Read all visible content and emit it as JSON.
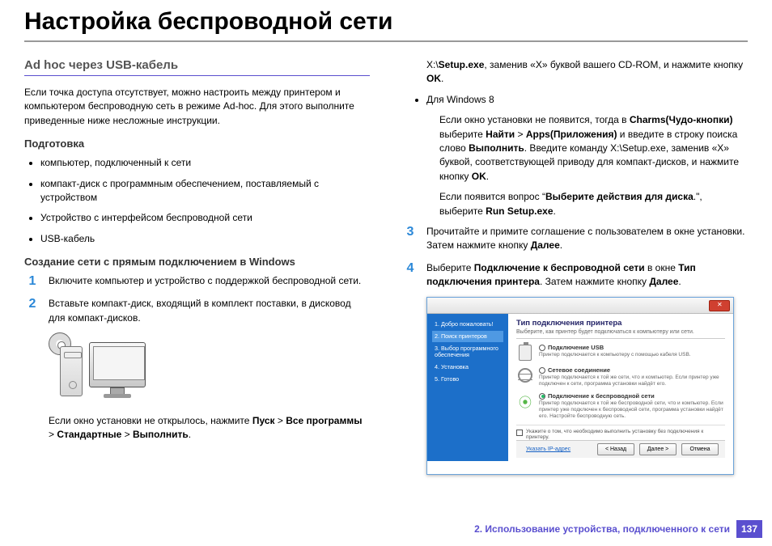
{
  "title": "Настройка беспроводной сети",
  "left": {
    "h2": "Ad hoc через USB-кабель",
    "intro": "Если точка доступа отсутствует, можно настроить между принтером и компьютером беспроводную сеть в режиме Ad-hoc. Для этого выполните приведенные ниже несложные инструкции.",
    "h3a": "Подготовка",
    "bullets": [
      "компьютер, подключенный к сети",
      "компакт-диск с программным обеспечением, поставляемый с устройством",
      "Устройство с интерфейсом беспроводной сети",
      "USB-кабель"
    ],
    "h3b": "Создание сети с прямым подключением в Windows",
    "step1": "Включите компьютер и устройство с поддержкой беспроводной сети.",
    "step2": "Вставьте компакт-диск, входящий в комплект поставки, в дисковод для компакт-дисков.",
    "note_indent_pre": "Если окно установки не открылось, нажмите ",
    "note_path": [
      "Пуск",
      "Все программы",
      "Стандартные",
      "Выполнить"
    ]
  },
  "right": {
    "topline_pre": "X:\\",
    "topline_setup": "Setup.exe",
    "topline_mid": ", заменив «X» буквой вашего CD-ROM, и нажмите кнопку ",
    "topline_ok": "OK",
    "win8_label": "Для Windows 8",
    "win8_p1a": "Если окно установки не появится, тогда в ",
    "win8_charms": "Charms(Чудо-кнопки)",
    "win8_p1b": " выберите ",
    "win8_find": "Найти",
    "win8_p1c": " > ",
    "win8_apps": "Apps(Приложения)",
    "win8_p1d": " и введите в строку поиска слово ",
    "win8_run": "Выполнить",
    "win8_p1e": ". Введите команду X:\\Setup.exe, заменив «X» буквой, соответствующей приводу для компакт-дисков, и нажмите кнопку ",
    "win8_ok": "OK",
    "win8_p2a": "Если появится вопрос “",
    "win8_p2b": "Выберите действия для диска",
    "win8_p2c": ".\", выберите ",
    "win8_runsetup": "Run Setup.exe",
    "step3a": "Прочитайте и примите соглашение с пользователем в окне установки. Затем нажмите кнопку ",
    "step3b": "Далее",
    "step4a": "Выберите ",
    "step4b": "Подключение к беспроводной сети",
    "step4c": " в окне ",
    "step4d": "Тип подключения принтера",
    "step4e": ". Затем нажмите кнопку ",
    "step4f": "Далее"
  },
  "dialog": {
    "side": [
      "1. Добро пожаловать!",
      "2. Поиск принтеров",
      "3. Выбор программного обеспечения",
      "4. Установка",
      "5. Готово"
    ],
    "heading": "Тип подключения принтера",
    "sub": "Выберите, как принтер будет подключаться к компьютеру или сети.",
    "opt1_t": "Подключение USB",
    "opt1_d": "Принтер подключается к компьютеру с помощью кабеля USB.",
    "opt2_t": "Сетевое соединение",
    "opt2_d": "Принтер подключается к той же сети, что и компьютер. Если принтер уже подключен к сети, программа установки найдёт его.",
    "opt3_t": "Подключение к беспроводной сети",
    "opt3_d": "Принтер подключается к той же беспроводной сети, что и компьютер. Если принтер уже подключен к беспроводной сети, программа установки найдёт его. Настройте беспроводную сеть.",
    "check": "Укажите о том, что необходимо выполнить установку без подключения к принтеру.",
    "ip": "Указать IP-адрес",
    "btn_back": "< Назад",
    "btn_next": "Далее >",
    "btn_cancel": "Отмена"
  },
  "footer": {
    "section": "2.  Использование устройства, подключенного к сети",
    "page": "137"
  }
}
